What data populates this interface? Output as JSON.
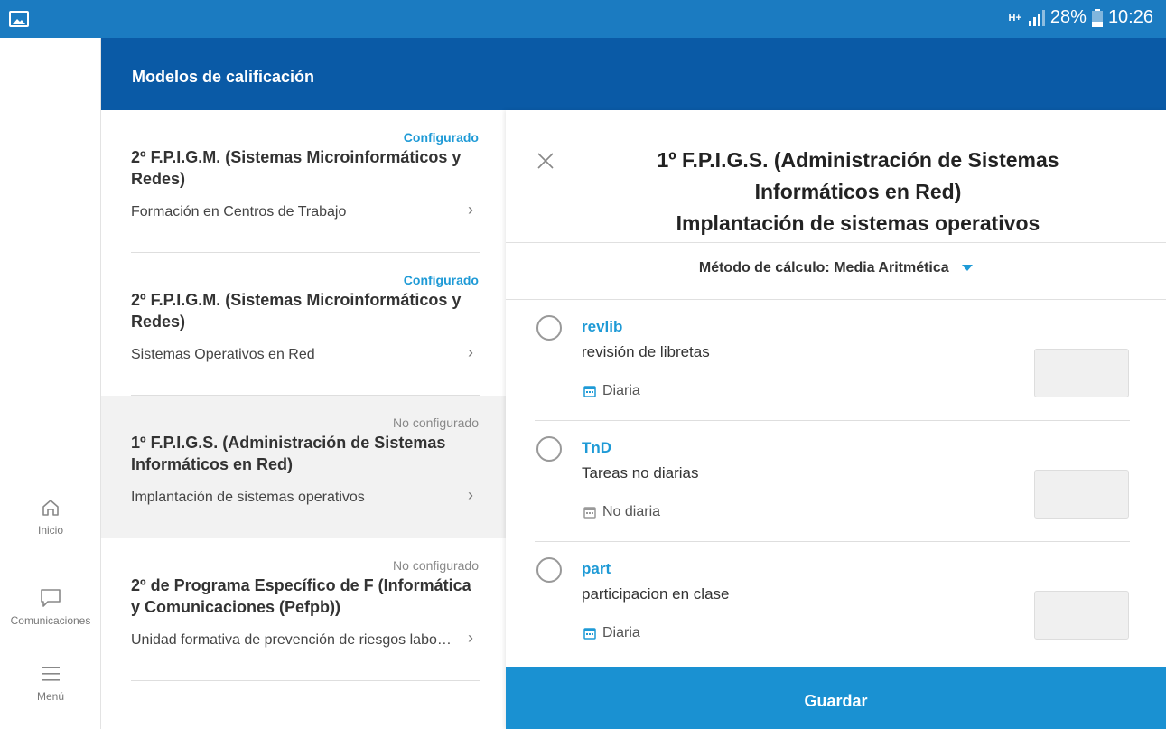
{
  "status_bar": {
    "network": "H+",
    "battery": "28%",
    "time": "10:26"
  },
  "rail": {
    "items": [
      {
        "label": "Inicio",
        "icon": "home-icon"
      },
      {
        "label": "Comunicaciones",
        "icon": "chat-icon"
      },
      {
        "label": "Menú",
        "icon": "menu-icon"
      }
    ]
  },
  "header": {
    "title": "Modelos de calificación"
  },
  "list": {
    "items": [
      {
        "status": "Configurado",
        "name": "2º F.P.I.G.M. (Sistemas Microinformáticos y Redes)",
        "subject": "Formación en Centros de Trabajo"
      },
      {
        "status": "Configurado",
        "name": "2º F.P.I.G.M. (Sistemas Microinformáticos y Redes)",
        "subject": "Sistemas Operativos en Red"
      },
      {
        "status": "No configurado",
        "name": "1º F.P.I.G.S. (Administración de Sistemas Informáticos en Red)",
        "subject": "Implantación de sistemas operativos"
      },
      {
        "status": "No configurado",
        "name": "2º de Programa Específico de F (Informática y Comunicaciones (Pefpb))",
        "subject": "Unidad formativa de prevención de riesgos laborales"
      }
    ]
  },
  "detail": {
    "title_line1": "1º F.P.I.G.S. (Administración de Sistemas",
    "title_line2": "Informáticos en Red)",
    "title_line3": "Implantación de sistemas operativos",
    "method_label": "Método de cálculo:",
    "method_value": "Media Aritmética",
    "criteria": [
      {
        "code": "revlib",
        "description": "revisión de libretas",
        "frequency": "Diaria"
      },
      {
        "code": "TnD",
        "description": "Tareas no diarias",
        "frequency": "No diaria"
      },
      {
        "code": "part",
        "description": "participacion en clase",
        "frequency": "Diaria"
      }
    ],
    "save_label": "Guardar"
  },
  "colors": {
    "status_bar": "#1b7bc1",
    "app_bar": "#0a5aa6",
    "accent": "#1e9ad6",
    "save_button": "#1a91d2"
  }
}
